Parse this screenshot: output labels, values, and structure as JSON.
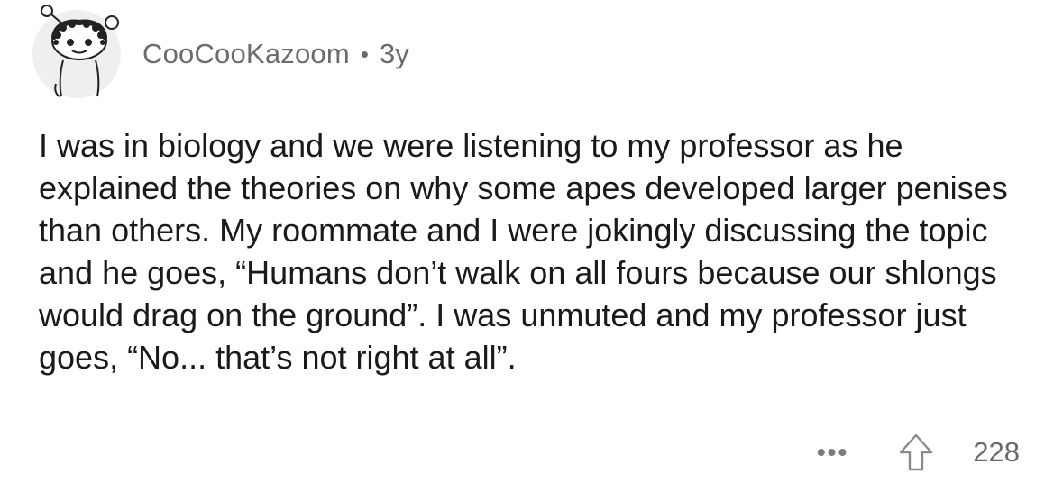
{
  "comment": {
    "author": "CooCooKazoom",
    "separator": "•",
    "age": "3y",
    "body": "I was in biology and we were listening to my professor as he explained the theories on why some apes developed larger penises than others. My roommate and I were jokingly discussing the topic and he goes, “Humans don’t walk on all fours because our shlongs would drag on the ground”. I was unmuted and my professor just goes, “No... that’s not right at all”.",
    "more_label": "•••",
    "vote_icon": "upvote-arrow-icon",
    "score": "228"
  },
  "colors": {
    "text": "#1a1a1b",
    "meta": "#6b6b6b",
    "avatar_bg": "#efefef"
  }
}
